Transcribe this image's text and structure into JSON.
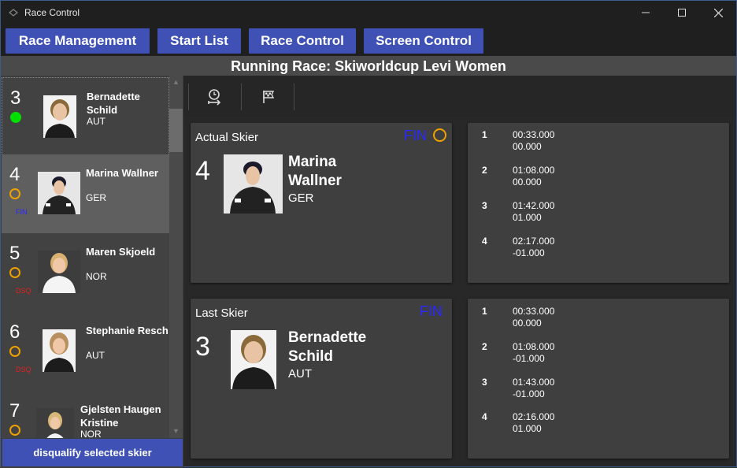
{
  "window": {
    "title": "Race Control",
    "controls": {
      "minimize": "—",
      "maximize": "☐",
      "close": "✕"
    }
  },
  "menu": {
    "items": [
      {
        "label": "Race Management"
      },
      {
        "label": "Start List"
      },
      {
        "label": "Race Control"
      },
      {
        "label": "Screen Control"
      }
    ]
  },
  "race": {
    "title": "Running Race: Skiworldcup Levi Women"
  },
  "colors": {
    "accent": "#3f51b5",
    "status_running": "#00e000",
    "status_ring": "#f0a000",
    "fin": "#2828ff",
    "dsq": "#e02020"
  },
  "skiers": [
    {
      "bib": "3",
      "name": "Bernadette Schild",
      "nat": "AUT",
      "status": "green-dot",
      "badge": ""
    },
    {
      "bib": "4",
      "name": "Marina Wallner",
      "nat": "GER",
      "status": "ring",
      "badge": "FIN"
    },
    {
      "bib": "5",
      "name": "Maren Skjoeld",
      "nat": "NOR",
      "status": "ring",
      "badge": "DSQ"
    },
    {
      "bib": "6",
      "name": "Stephanie Resch",
      "nat": "AUT",
      "status": "ring",
      "badge": "DSQ"
    },
    {
      "bib": "7",
      "name": "Gjelsten Haugen Kristine",
      "nat": "NOR",
      "status": "ring",
      "badge": ""
    }
  ],
  "scroll": {
    "up": "▲",
    "down": "▼"
  },
  "actions": {
    "disqualify": "disqualify selected skier"
  },
  "toolbar": {
    "icons": [
      "stopwatch-icon",
      "finish-flag-icon"
    ]
  },
  "actual": {
    "label": "Actual Skier",
    "fin": "FIN",
    "bib": "4",
    "name": "Marina Wallner",
    "nat": "GER",
    "splits": [
      {
        "n": "1",
        "time": "00:33.000",
        "diff": "00.000"
      },
      {
        "n": "2",
        "time": "01:08.000",
        "diff": "00.000"
      },
      {
        "n": "3",
        "time": "01:42.000",
        "diff": "01.000"
      },
      {
        "n": "4",
        "time": "02:17.000",
        "diff": "-01.000"
      }
    ]
  },
  "last": {
    "label": "Last Skier",
    "fin": "FIN",
    "bib": "3",
    "name": "Bernadette Schild",
    "nat": "AUT",
    "splits": [
      {
        "n": "1",
        "time": "00:33.000",
        "diff": "00.000"
      },
      {
        "n": "2",
        "time": "01:08.000",
        "diff": "-01.000"
      },
      {
        "n": "3",
        "time": "01:43.000",
        "diff": "-01.000"
      },
      {
        "n": "4",
        "time": "02:16.000",
        "diff": "01.000"
      }
    ]
  }
}
